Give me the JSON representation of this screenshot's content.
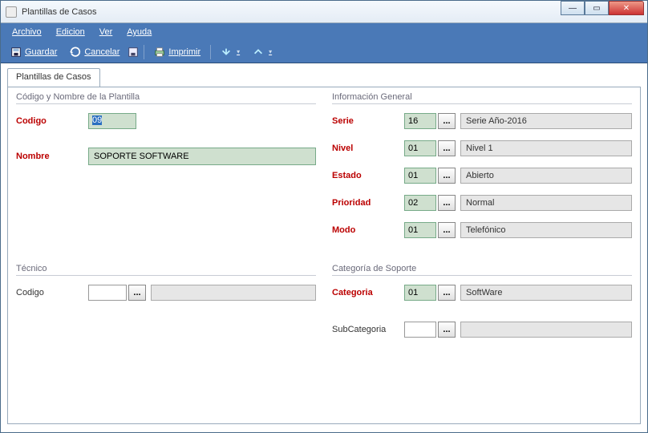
{
  "window": {
    "title": "Plantillas de Casos"
  },
  "menubar": {
    "archivo": "Archivo",
    "edicion": "Edicion",
    "ver": "Ver",
    "ayuda": "Ayuda"
  },
  "toolbar": {
    "guardar": "Guardar",
    "cancelar": "Cancelar",
    "imprimir": "Imprimir"
  },
  "tab": {
    "label": "Plantillas de Casos"
  },
  "group_codigo_nombre": {
    "title": "Código y Nombre de la Plantilla",
    "codigo_label": "Codigo",
    "codigo_value": "09",
    "nombre_label": "Nombre",
    "nombre_value": "SOPORTE SOFTWARE"
  },
  "group_info": {
    "title": "Información General",
    "serie": {
      "label": "Serie",
      "code": "16",
      "text": "Serie Año-2016"
    },
    "nivel": {
      "label": "Nivel",
      "code": "01",
      "text": "Nivel 1"
    },
    "estado": {
      "label": "Estado",
      "code": "01",
      "text": "Abierto"
    },
    "prioridad": {
      "label": "Prioridad",
      "code": "02",
      "text": "Normal"
    },
    "modo": {
      "label": "Modo",
      "code": "01",
      "text": "Telefónico"
    }
  },
  "group_tecnico": {
    "title": "Técnico",
    "codigo_label": "Codigo",
    "codigo_value": "",
    "text": ""
  },
  "group_categoria": {
    "title": "Categoría de Soporte",
    "categoria": {
      "label": "Categoria",
      "code": "01",
      "text": "SoftWare"
    },
    "subcategoria": {
      "label": "SubCategoria",
      "code": "",
      "text": ""
    }
  },
  "ellipsis": "..."
}
